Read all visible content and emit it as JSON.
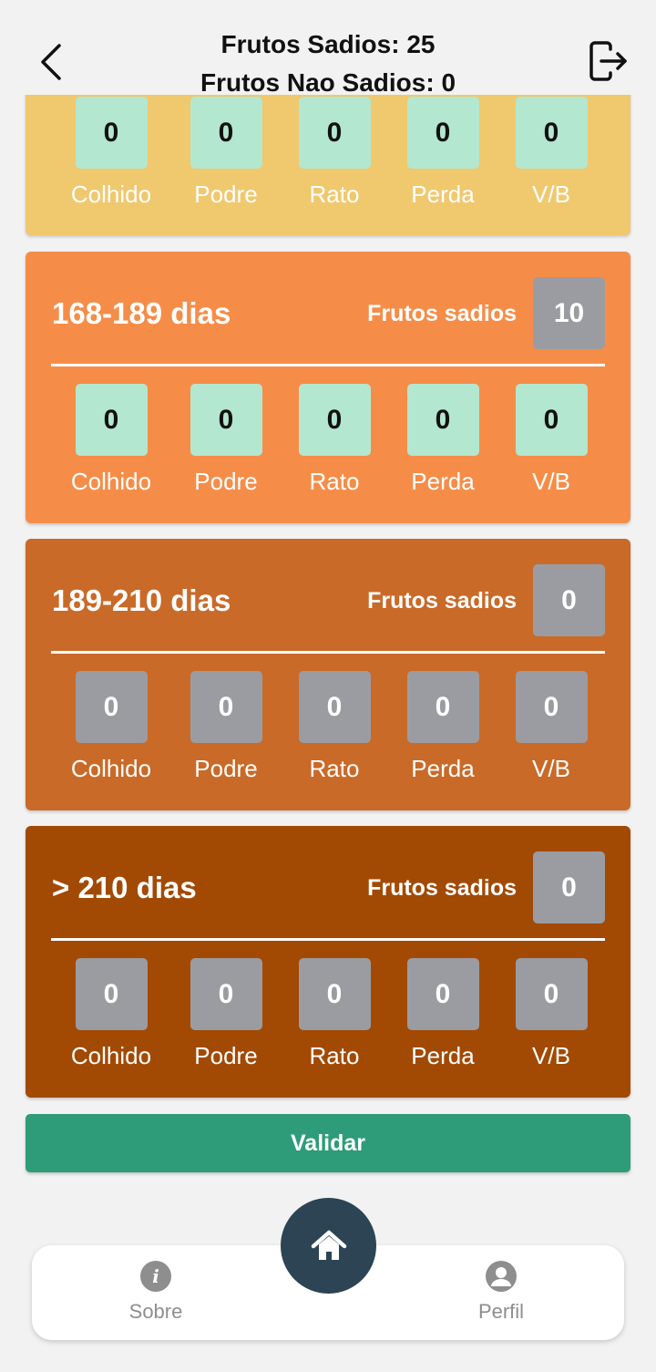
{
  "header": {
    "line1": "Frutos Sadios: 25",
    "line2": "Frutos Nao Sadios: 0",
    "back_icon": "chevron-left-icon",
    "logout_icon": "logout-icon"
  },
  "categories": [
    "Colhido",
    "Podre",
    "Rato",
    "Perda",
    "V/B"
  ],
  "cards": [
    {
      "color": "#f0c86e",
      "partial": true,
      "values": [
        "0",
        "0",
        "0",
        "0",
        "0"
      ],
      "value_style": "green"
    },
    {
      "color": "#f58d48",
      "title": "168-189 dias",
      "sadios_label": "Frutos sadios",
      "sadios_value": "10",
      "values": [
        "0",
        "0",
        "0",
        "0",
        "0"
      ],
      "value_style": "green"
    },
    {
      "color": "#c96a28",
      "title": "189-210 dias",
      "sadios_label": "Frutos sadios",
      "sadios_value": "0",
      "values": [
        "0",
        "0",
        "0",
        "0",
        "0"
      ],
      "value_style": "gray"
    },
    {
      "color": "#a24a03",
      "title": "> 210 dias",
      "sadios_label": "Frutos sadios",
      "sadios_value": "0",
      "values": [
        "0",
        "0",
        "0",
        "0",
        "0"
      ],
      "value_style": "gray"
    }
  ],
  "validar_label": "Validar",
  "nav": {
    "sobre_label": "Sobre",
    "perfil_label": "Perfil",
    "home_icon": "home-icon",
    "sobre_icon": "info-icon",
    "perfil_icon": "user-icon"
  }
}
